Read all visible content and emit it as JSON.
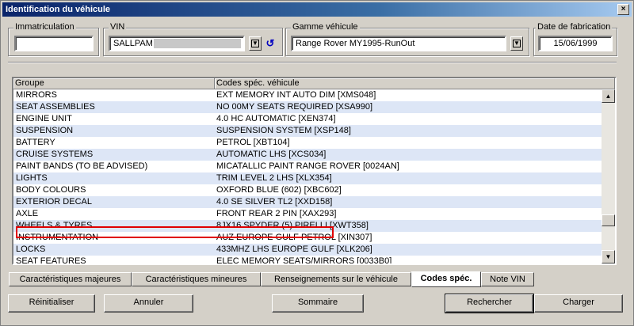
{
  "window": {
    "title": "Identification du véhicule",
    "close_glyph": "×"
  },
  "header": {
    "registration": {
      "label": "Immatriculation",
      "value": ""
    },
    "vin": {
      "label": "VIN",
      "value": "SALLPAM"
    },
    "range": {
      "label": "Gamme véhicule",
      "value": "Range Rover MY1995-RunOut"
    },
    "build_date": {
      "label": "Date de fabrication",
      "value": "15/06/1999"
    },
    "dropdown_glyph": "▼",
    "refresh_glyph": "↺"
  },
  "table": {
    "columns": [
      "Groupe",
      "Codes spéc. véhicule"
    ],
    "rows": [
      {
        "group": "MIRRORS",
        "code": "EXT MEMORY INT AUTO DIM   [XMS048]"
      },
      {
        "group": "SEAT ASSEMBLIES",
        "code": "NO 00MY SEATS REQUIRED   [XSA990]"
      },
      {
        "group": "ENGINE UNIT",
        "code": "4.0 HC AUTOMATIC   [XEN374]"
      },
      {
        "group": "SUSPENSION",
        "code": "SUSPENSION SYSTEM   [XSP148]"
      },
      {
        "group": "BATTERY",
        "code": "PETROL   [XBT104]"
      },
      {
        "group": "CRUISE SYSTEMS",
        "code": "AUTOMATIC LHS   [XCS034]"
      },
      {
        "group": "PAINT BANDS (TO BE ADVISED)",
        "code": "MICATALLIC PAINT RANGE ROVER   [0024AN]"
      },
      {
        "group": "LIGHTS",
        "code": "TRIM LEVEL 2 LHS   [XLX354]"
      },
      {
        "group": "BODY COLOURS",
        "code": "OXFORD BLUE (602)   [XBC602]"
      },
      {
        "group": "EXTERIOR DECAL",
        "code": "4.0 SE SILVER TL2   [XXD158]"
      },
      {
        "group": "AXLE",
        "code": "FRONT REAR 2 PIN   [XAX293]"
      },
      {
        "group": "WHEELS & TYRES",
        "code": "8JX16 SPYDER (5) PIRELLI   [XWT358]"
      },
      {
        "group": "INSTRUMENTATION",
        "code": "AUZ EUROPE GULF PETROL   [XIN307]"
      },
      {
        "group": "LOCKS",
        "code": "433MHZ LHS EUROPE GULF   [XLK206]"
      },
      {
        "group": "SEAT FEATURES",
        "code": "ELEC MEMORY SEATS/MIRRORS   [0033B0]"
      }
    ],
    "scroll_up_glyph": "▲",
    "scroll_down_glyph": "▼"
  },
  "tabs": [
    {
      "label": "Caractéristiques majeures"
    },
    {
      "label": "Caractéristiques mineures"
    },
    {
      "label": "Renseignements sur le véhicule"
    },
    {
      "label": "Codes spéc."
    },
    {
      "label": "Note VIN"
    }
  ],
  "buttons": {
    "reset": "Réinitialiser",
    "cancel": "Annuler",
    "summary": "Sommaire",
    "search": "Rechercher",
    "load": "Charger"
  },
  "colors": {
    "highlight": "#e00000",
    "row_alt": "#dde6f6",
    "title_bar": "#0a246a"
  }
}
